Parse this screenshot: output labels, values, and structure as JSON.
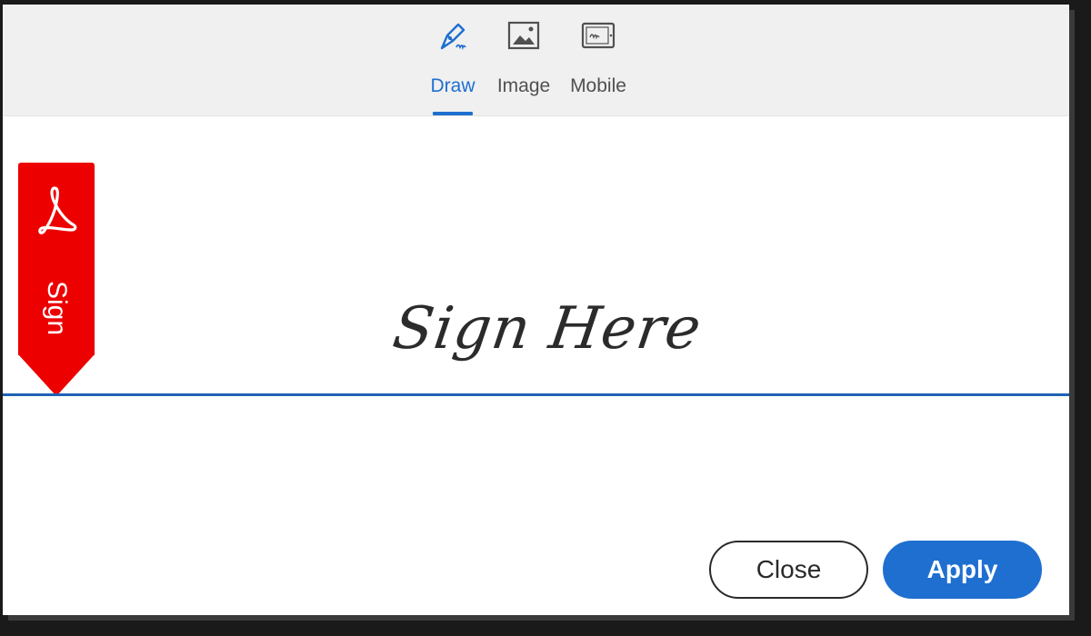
{
  "tabs": [
    {
      "id": "draw",
      "label": "Draw",
      "icon": "pen-draw-icon",
      "active": true
    },
    {
      "id": "image",
      "label": "Image",
      "icon": "image-icon",
      "active": false
    },
    {
      "id": "mobile",
      "label": "Mobile",
      "icon": "mobile-icon",
      "active": false
    }
  ],
  "sign_tag": {
    "label": "Sign",
    "icon": "acrobat-logo-icon"
  },
  "signature": {
    "text": "Sign Here"
  },
  "buttons": {
    "close_label": "Close",
    "apply_label": "Apply"
  },
  "colors": {
    "accent": "#1f6fd0",
    "tag_red": "#ec0000",
    "signature_line": "#1f63b5",
    "tab_bar": "#f0f0f0"
  }
}
